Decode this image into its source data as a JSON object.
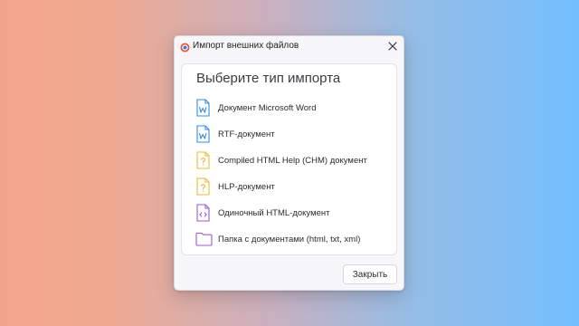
{
  "dialog": {
    "title": "Импорт внешних файлов",
    "app_icon": "app-logo-icon",
    "close_icon": "close-icon"
  },
  "panel": {
    "heading": "Выберите тип импорта",
    "items": [
      {
        "label": "Документ Microsoft Word",
        "icon": "word-document-icon",
        "color": "#2f8ce3"
      },
      {
        "label": "RTF-документ",
        "icon": "word-document-icon",
        "color": "#2f8ce3"
      },
      {
        "label": "Compiled HTML Help (CHM) документ",
        "icon": "help-document-icon",
        "color": "#efb93a"
      },
      {
        "label": "HLP-документ",
        "icon": "help-document-icon",
        "color": "#efb93a"
      },
      {
        "label": "Одиночный HTML-документ",
        "icon": "html-document-icon",
        "color": "#9a5bd8"
      },
      {
        "label": "Папка с документами (html, txt, xml)",
        "icon": "folder-icon",
        "color": "#9a5bd8"
      }
    ]
  },
  "footer": {
    "close_button_label": "Закрыть"
  }
}
